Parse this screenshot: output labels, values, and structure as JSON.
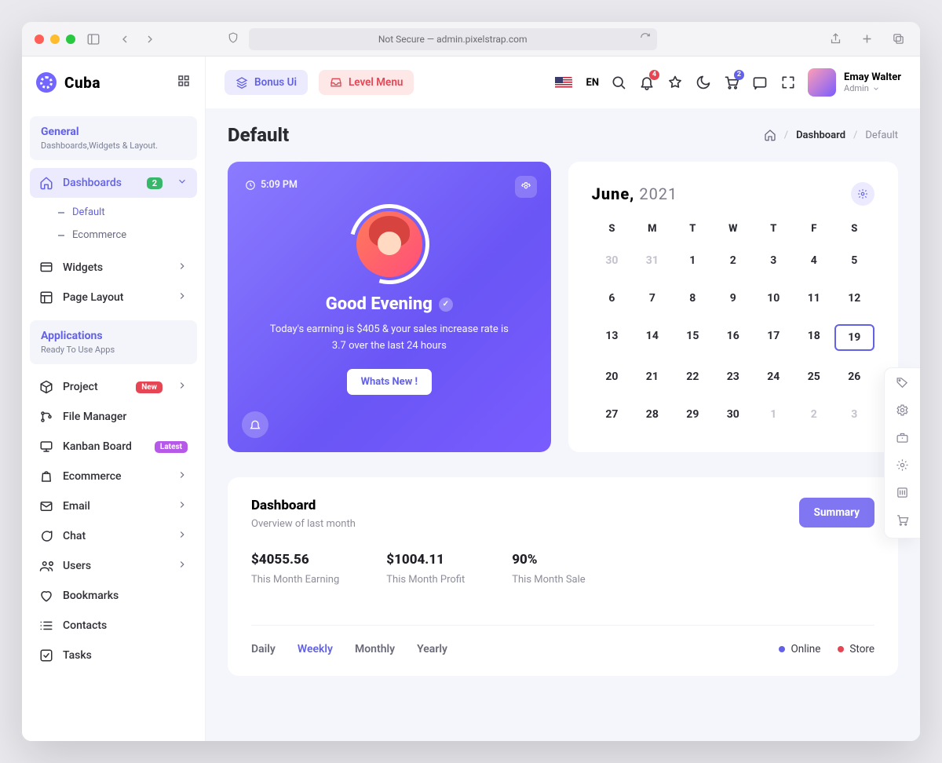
{
  "browser": {
    "address": "Not Secure — admin.pixelstrap.com"
  },
  "brand": {
    "name": "Cuba"
  },
  "header": {
    "bonus": "Bonus Ui",
    "level": "Level Menu",
    "lang": "EN",
    "notif_badge": "4",
    "cart_badge": "2",
    "user_name": "Emay Walter",
    "user_role": "Admin"
  },
  "sidebar": {
    "general": {
      "title": "General",
      "sub": "Dashboards,Widgets & Layout."
    },
    "dashboards": {
      "label": "Dashboards",
      "badge": "2",
      "sub": {
        "default": "Default",
        "ecommerce": "Ecommerce"
      }
    },
    "widgets": "Widgets",
    "page_layout": "Page Layout",
    "applications": {
      "title": "Applications",
      "sub": "Ready To Use Apps"
    },
    "project": {
      "label": "Project",
      "pill": "New"
    },
    "file_manager": "File Manager",
    "kanban": {
      "label": "Kanban Board",
      "pill": "Latest"
    },
    "ecommerce": "Ecommerce",
    "email": "Email",
    "chat": "Chat",
    "users": "Users",
    "bookmarks": "Bookmarks",
    "contacts": "Contacts",
    "tasks": "Tasks"
  },
  "breadcrumb": {
    "title": "Default",
    "dashboard": "Dashboard",
    "page": "Default"
  },
  "greet": {
    "time": "5:09 PM",
    "heading": "Good Evening",
    "body": "Today's earrning is $405 & your sales increase rate is 3.7 over the last 24 hours",
    "cta": "Whats New !"
  },
  "calendar": {
    "month": "June,",
    "year": "2021",
    "dow": [
      "S",
      "M",
      "T",
      "W",
      "T",
      "F",
      "S"
    ],
    "lead_mute": [
      "30",
      "31"
    ],
    "days": [
      "1",
      "2",
      "3",
      "4",
      "5",
      "6",
      "7",
      "8",
      "9",
      "10",
      "11",
      "12",
      "13",
      "14",
      "15",
      "16",
      "17",
      "18",
      "19",
      "20",
      "21",
      "22",
      "23",
      "24",
      "25",
      "26",
      "27",
      "28",
      "29",
      "30"
    ],
    "trail_mute": [
      "1",
      "2",
      "3"
    ],
    "selected": "19"
  },
  "dashboard": {
    "title": "Dashboard",
    "sub": "Overview of last month",
    "button": "Summary",
    "stats": [
      {
        "num": "$4055.56",
        "lbl": "This Month Earning"
      },
      {
        "num": "$1004.11",
        "lbl": "This Month Profit"
      },
      {
        "num": "90%",
        "lbl": "This Month Sale"
      }
    ],
    "tabs": {
      "daily": "Daily",
      "weekly": "Weekly",
      "monthly": "Monthly",
      "yearly": "Yearly"
    },
    "legend": {
      "online": "Online",
      "store": "Store"
    }
  }
}
